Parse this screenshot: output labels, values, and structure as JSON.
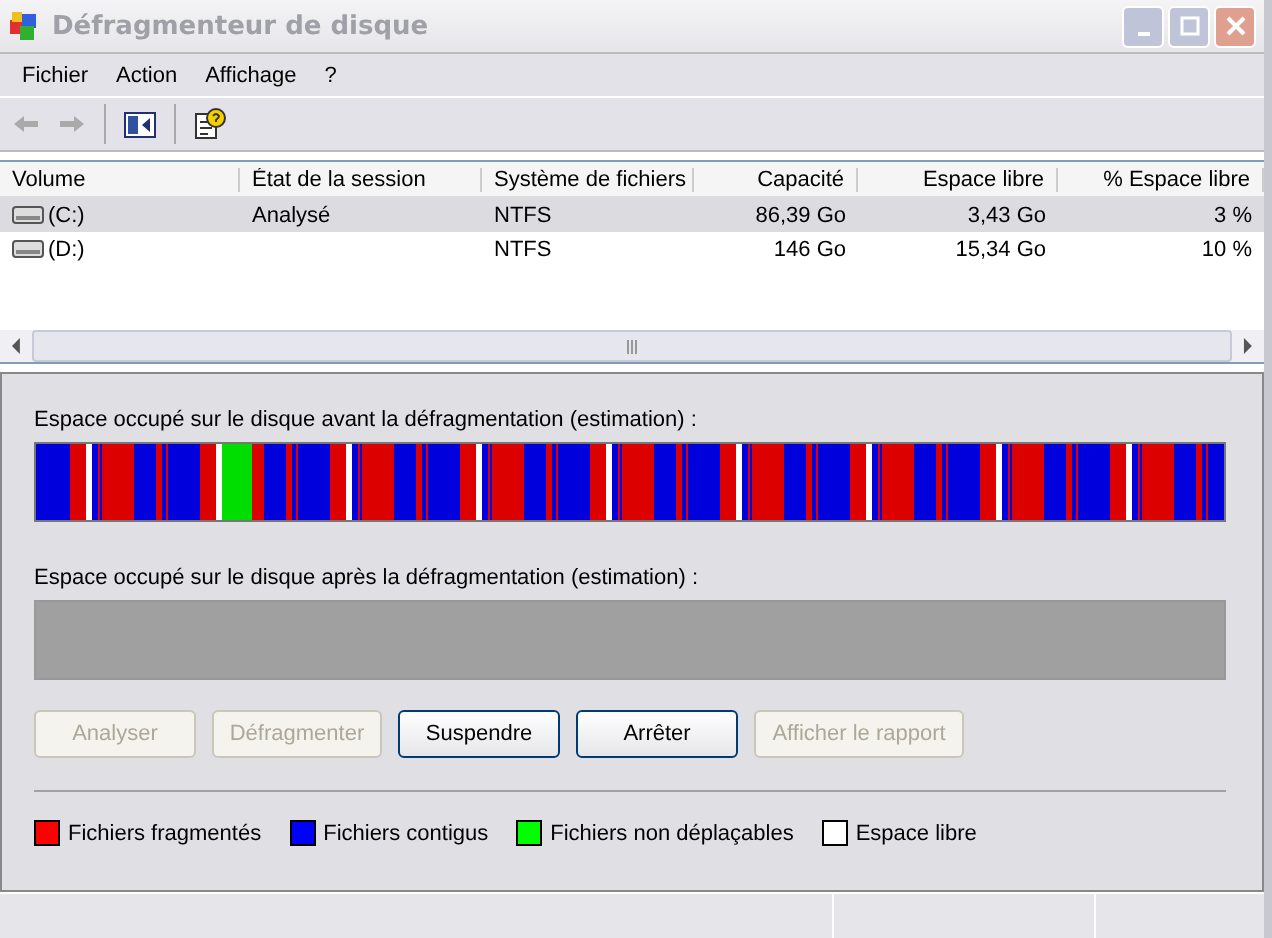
{
  "window": {
    "title": "Défragmenteur de disque"
  },
  "menu": [
    "Fichier",
    "Action",
    "Affichage",
    "?"
  ],
  "table": {
    "columns": [
      "Volume",
      "État de la session",
      "Système de fichiers",
      "Capacité",
      "Espace libre",
      "% Espace libre"
    ],
    "rows": [
      {
        "selected": true,
        "cells": [
          "(C:)",
          "Analysé",
          "NTFS",
          "86,39 Go",
          "3,43 Go",
          "3 %"
        ]
      },
      {
        "selected": false,
        "cells": [
          "(D:)",
          "",
          "NTFS",
          "146 Go",
          "15,34 Go",
          "10 %"
        ]
      }
    ]
  },
  "before_label": "Espace occupé sur le disque avant la défragmentation (estimation) :",
  "after_label": "Espace occupé sur le disque après la défragmentation (estimation) :",
  "buttons": [
    {
      "label": "Analyser",
      "disabled": true
    },
    {
      "label": "Défragmenter",
      "disabled": true
    },
    {
      "label": "Suspendre",
      "disabled": false
    },
    {
      "label": "Arrêter",
      "disabled": false
    },
    {
      "label": "Afficher le rapport",
      "disabled": true
    }
  ],
  "legend": [
    {
      "label": "Fichiers fragmentés",
      "color": "#ff0000"
    },
    {
      "label": "Fichiers contigus",
      "color": "#0000ff"
    },
    {
      "label": "Fichiers non déplaçables",
      "color": "#00ff00"
    },
    {
      "label": "Espace libre",
      "color": "#ffffff"
    }
  ]
}
